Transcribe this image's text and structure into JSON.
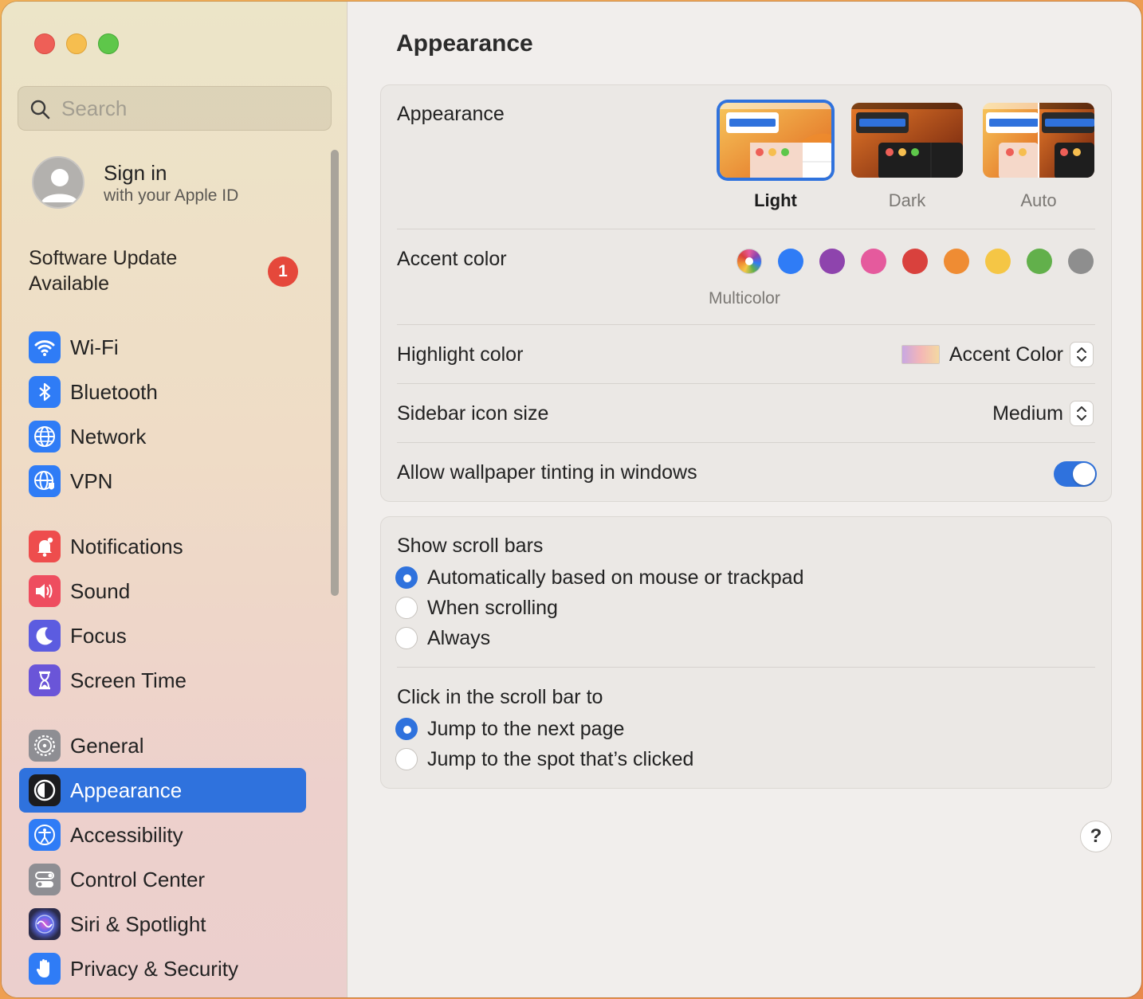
{
  "window": {
    "traffic_lights": [
      "close",
      "minimize",
      "zoom"
    ]
  },
  "sidebar": {
    "search": {
      "placeholder": "Search",
      "value": ""
    },
    "account": {
      "title": "Sign in",
      "subtitle": "with your Apple ID"
    },
    "update": {
      "label": "Software Update Available",
      "badge": "1"
    },
    "groups": [
      [
        {
          "label": "Wi-Fi",
          "icon": "wifi-icon",
          "color": "#2f7cf6"
        },
        {
          "label": "Bluetooth",
          "icon": "bluetooth-icon",
          "color": "#2f7cf6"
        },
        {
          "label": "Network",
          "icon": "globe-icon",
          "color": "#2f7cf6"
        },
        {
          "label": "VPN",
          "icon": "vpn-globe-icon",
          "color": "#2f7cf6"
        }
      ],
      [
        {
          "label": "Notifications",
          "icon": "bell-icon",
          "color": "#ee4d4d"
        },
        {
          "label": "Sound",
          "icon": "speaker-icon",
          "color": "#ee4d5f"
        },
        {
          "label": "Focus",
          "icon": "moon-icon",
          "color": "#5c5ce0"
        },
        {
          "label": "Screen Time",
          "icon": "hourglass-icon",
          "color": "#6a55d8"
        }
      ],
      [
        {
          "label": "General",
          "icon": "gear-icon",
          "color": "#8e8e93"
        },
        {
          "label": "Appearance",
          "icon": "appearance-icon",
          "color": "#1c1c1e",
          "selected": true
        },
        {
          "label": "Accessibility",
          "icon": "accessibility-icon",
          "color": "#2f7cf6"
        },
        {
          "label": "Control Center",
          "icon": "control-center-icon",
          "color": "#8e8e93"
        },
        {
          "label": "Siri & Spotlight",
          "icon": "siri-icon",
          "color": "#2b2b4a"
        },
        {
          "label": "Privacy & Security",
          "icon": "hand-icon",
          "color": "#2f7cf6"
        }
      ]
    ]
  },
  "main": {
    "title": "Appearance",
    "appearance": {
      "label": "Appearance",
      "options": [
        {
          "label": "Light",
          "selected": true
        },
        {
          "label": "Dark",
          "selected": false
        },
        {
          "label": "Auto",
          "selected": false
        }
      ]
    },
    "accent": {
      "label": "Accent color",
      "caption": "Multicolor",
      "colors": [
        "multicolor",
        "#2f7cf6",
        "#8e44ad",
        "#e55a9d",
        "#d9413d",
        "#ef8c33",
        "#f5c645",
        "#62b04b",
        "#8e8e8e"
      ]
    },
    "highlight": {
      "label": "Highlight color",
      "value": "Accent Color"
    },
    "icon_size": {
      "label": "Sidebar icon size",
      "value": "Medium"
    },
    "tinting": {
      "label": "Allow wallpaper tinting in windows",
      "enabled": true
    },
    "scroll_bars": {
      "label": "Show scroll bars",
      "options": [
        {
          "label": "Automatically based on mouse or trackpad",
          "checked": true
        },
        {
          "label": "When scrolling",
          "checked": false
        },
        {
          "label": "Always",
          "checked": false
        }
      ]
    },
    "click_scroll": {
      "label": "Click in the scroll bar to",
      "options": [
        {
          "label": "Jump to the next page",
          "checked": true
        },
        {
          "label": "Jump to the spot that’s clicked",
          "checked": false
        }
      ]
    },
    "help": "?"
  }
}
